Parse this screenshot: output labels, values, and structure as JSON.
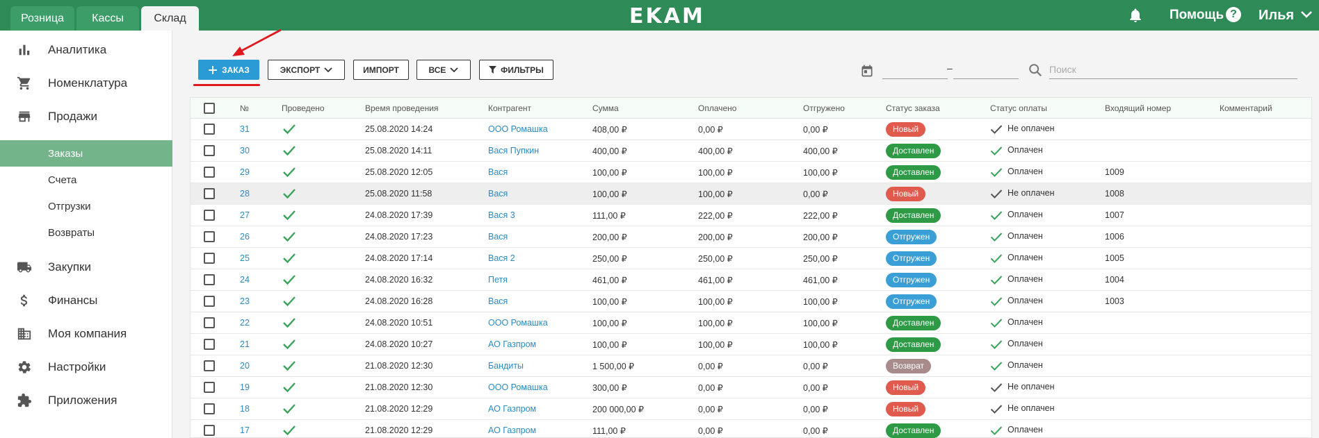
{
  "colors": {
    "topbar": "#2e8b57",
    "primary": "#2a9bd4",
    "link": "#2a8bc4",
    "check": "#3aa35a",
    "status_new": "#e05a4e",
    "status_delivered": "#2e9a45",
    "status_shipped": "#3a9fd6",
    "status_returned": "#a88b8b",
    "highlight": "#e0191f"
  },
  "top_tabs": [
    {
      "label": "Розница",
      "active": false
    },
    {
      "label": "Кассы",
      "active": false
    },
    {
      "label": "Склад",
      "active": true
    }
  ],
  "logo": "EKAM",
  "header": {
    "help_label": "Помощь",
    "help_icon": "?",
    "user_name": "Илья"
  },
  "sidebar": {
    "items": [
      {
        "label": "Аналитика",
        "icon": "bar-chart-icon"
      },
      {
        "label": "Номенклатура",
        "icon": "cart-icon"
      },
      {
        "label": "Продажи",
        "icon": "store-icon"
      },
      {
        "label": "Закупки",
        "icon": "truck-icon"
      },
      {
        "label": "Финансы",
        "icon": "dollar-icon"
      },
      {
        "label": "Моя компания",
        "icon": "building-icon"
      },
      {
        "label": "Настройки",
        "icon": "gear-icon"
      },
      {
        "label": "Приложения",
        "icon": "puzzle-icon"
      }
    ],
    "subitems": [
      {
        "label": "Заказы",
        "active": true
      },
      {
        "label": "Счета",
        "active": false
      },
      {
        "label": "Отгрузки",
        "active": false
      },
      {
        "label": "Возвраты",
        "active": false
      }
    ]
  },
  "toolbar": {
    "add_label": "ЗАКАЗ",
    "export_label": "ЭКСПОРТ",
    "import_label": "ИМПОРТ",
    "all_label": "ВСЕ",
    "filters_label": "ФИЛЬТРЫ",
    "date_separator": "–",
    "date_from": "",
    "date_to": "",
    "search_value": "",
    "search_placeholder": "Поиск"
  },
  "table": {
    "columns": [
      "№",
      "Проведено",
      "Время проведения",
      "Контрагент",
      "Сумма",
      "Оплачено",
      "Отгружено",
      "Статус заказа",
      "Статус оплаты",
      "Входящий номер",
      "Комментарий"
    ],
    "rows": [
      {
        "num": "31",
        "time": "25.08.2020 14:24",
        "party": "ООО Ромашка",
        "sum": "408,00 ₽",
        "paid": "0,00 ₽",
        "shipped": "0,00 ₽",
        "status": "Новый",
        "status_key": "new",
        "payment": "Не оплачен",
        "incoming": "",
        "comment": "",
        "highlighted": false
      },
      {
        "num": "30",
        "time": "25.08.2020 14:11",
        "party": "Вася Пупкин",
        "sum": "400,00 ₽",
        "paid": "400,00 ₽",
        "shipped": "400,00 ₽",
        "status": "Доставлен",
        "status_key": "delivered",
        "payment": "Оплачен",
        "incoming": "",
        "comment": "",
        "highlighted": false
      },
      {
        "num": "29",
        "time": "25.08.2020 12:05",
        "party": "Вася",
        "sum": "100,00 ₽",
        "paid": "100,00 ₽",
        "shipped": "100,00 ₽",
        "status": "Доставлен",
        "status_key": "delivered",
        "payment": "Оплачен",
        "incoming": "1009",
        "comment": "",
        "highlighted": false
      },
      {
        "num": "28",
        "time": "25.08.2020 11:58",
        "party": "Вася",
        "sum": "100,00 ₽",
        "paid": "100,00 ₽",
        "shipped": "0,00 ₽",
        "status": "Новый",
        "status_key": "new",
        "payment": "Не оплачен",
        "incoming": "1008",
        "comment": "",
        "highlighted": true
      },
      {
        "num": "27",
        "time": "24.08.2020 17:39",
        "party": "Вася 3",
        "sum": "111,00 ₽",
        "paid": "222,00 ₽",
        "shipped": "222,00 ₽",
        "status": "Доставлен",
        "status_key": "delivered",
        "payment": "Оплачен",
        "incoming": "1007",
        "comment": "",
        "highlighted": false
      },
      {
        "num": "26",
        "time": "24.08.2020 17:23",
        "party": "Вася",
        "sum": "200,00 ₽",
        "paid": "200,00 ₽",
        "shipped": "200,00 ₽",
        "status": "Отгружен",
        "status_key": "shipped",
        "payment": "Оплачен",
        "incoming": "1006",
        "comment": "",
        "highlighted": false
      },
      {
        "num": "25",
        "time": "24.08.2020 17:14",
        "party": "Вася 2",
        "sum": "250,00 ₽",
        "paid": "250,00 ₽",
        "shipped": "250,00 ₽",
        "status": "Отгружен",
        "status_key": "shipped",
        "payment": "Оплачен",
        "incoming": "1005",
        "comment": "",
        "highlighted": false
      },
      {
        "num": "24",
        "time": "24.08.2020 16:32",
        "party": "Петя",
        "sum": "461,00 ₽",
        "paid": "461,00 ₽",
        "shipped": "461,00 ₽",
        "status": "Отгружен",
        "status_key": "shipped",
        "payment": "Оплачен",
        "incoming": "1004",
        "comment": "",
        "highlighted": false
      },
      {
        "num": "23",
        "time": "24.08.2020 16:28",
        "party": "Вася",
        "sum": "100,00 ₽",
        "paid": "100,00 ₽",
        "shipped": "100,00 ₽",
        "status": "Отгружен",
        "status_key": "shipped",
        "payment": "Оплачен",
        "incoming": "1003",
        "comment": "",
        "highlighted": false
      },
      {
        "num": "22",
        "time": "24.08.2020 10:51",
        "party": "ООО Ромашка",
        "sum": "100,00 ₽",
        "paid": "100,00 ₽",
        "shipped": "100,00 ₽",
        "status": "Доставлен",
        "status_key": "delivered",
        "payment": "Оплачен",
        "incoming": "",
        "comment": "",
        "highlighted": false
      },
      {
        "num": "21",
        "time": "24.08.2020 10:27",
        "party": "АО Газпром",
        "sum": "100,00 ₽",
        "paid": "100,00 ₽",
        "shipped": "100,00 ₽",
        "status": "Доставлен",
        "status_key": "delivered",
        "payment": "Оплачен",
        "incoming": "",
        "comment": "",
        "highlighted": false
      },
      {
        "num": "20",
        "time": "21.08.2020 12:30",
        "party": "Бандиты",
        "sum": "1 500,00 ₽",
        "paid": "0,00 ₽",
        "shipped": "0,00 ₽",
        "status": "Возврат",
        "status_key": "returned",
        "payment": "Оплачен",
        "incoming": "",
        "comment": "",
        "highlighted": false
      },
      {
        "num": "19",
        "time": "21.08.2020 12:30",
        "party": "ООО Ромашка",
        "sum": "300,00 ₽",
        "paid": "0,00 ₽",
        "shipped": "0,00 ₽",
        "status": "Новый",
        "status_key": "new",
        "payment": "Не оплачен",
        "incoming": "",
        "comment": "",
        "highlighted": false
      },
      {
        "num": "18",
        "time": "21.08.2020 12:29",
        "party": "АО Газпром",
        "sum": "200 000,00 ₽",
        "paid": "0,00 ₽",
        "shipped": "0,00 ₽",
        "status": "Новый",
        "status_key": "new",
        "payment": "Не оплачен",
        "incoming": "",
        "comment": "",
        "highlighted": false
      },
      {
        "num": "17",
        "time": "21.08.2020 12:29",
        "party": "АО Газпром",
        "sum": "111,00 ₽",
        "paid": "0,00 ₽",
        "shipped": "0,00 ₽",
        "status": "Доставлен",
        "status_key": "delivered",
        "payment": "Оплачен",
        "incoming": "",
        "comment": "",
        "highlighted": false
      }
    ]
  }
}
